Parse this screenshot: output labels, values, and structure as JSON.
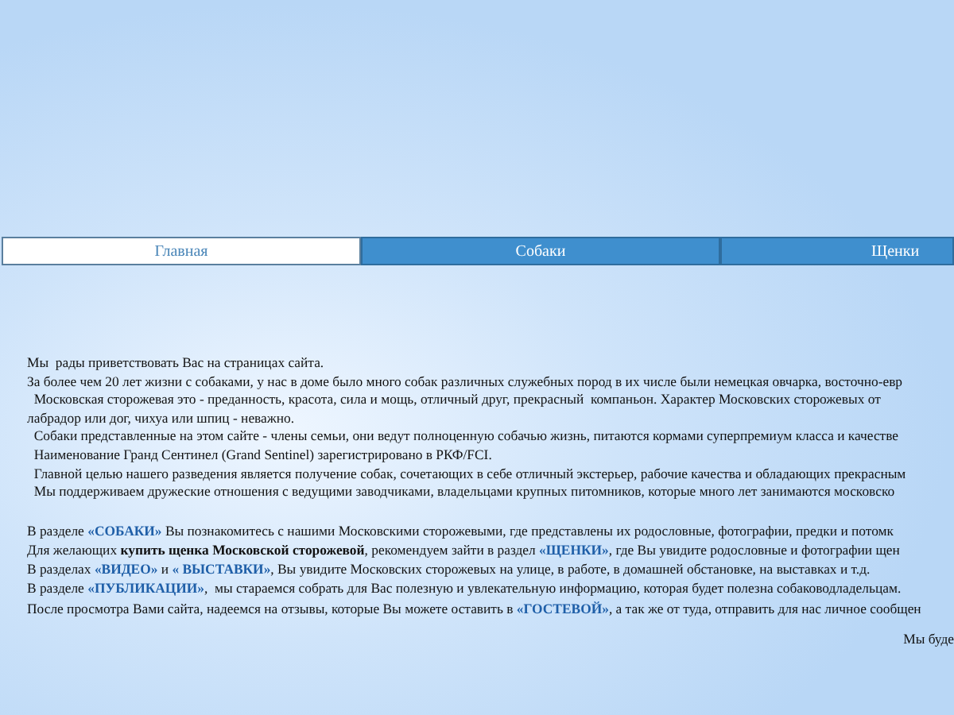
{
  "tabs": [
    {
      "label": "Главная",
      "selected": true
    },
    {
      "label": "Собаки",
      "selected": false
    },
    {
      "label": "Щенки",
      "selected": false
    }
  ],
  "intro": [
    [
      {
        "kind": "text",
        "text": "Мы  рады приветствовать Вас на страницах сайта."
      }
    ],
    [
      {
        "kind": "text",
        "text": "За более чем 20 лет жизни с собаками, у нас в доме было много собак различных служебных пород в их числе были немецкая овчарка, восточно-евр"
      }
    ],
    [
      {
        "kind": "text",
        "text": "  Московская сторожевая это - преданность, красота, сила и мощь, отличный друг, прекрасный  компаньон. Характер Московских сторожевых от"
      }
    ],
    [
      {
        "kind": "text",
        "text": "лабрадор или дог, чихуа или шпиц - неважно."
      }
    ],
    [
      {
        "kind": "text",
        "text": "  Собаки представленные на этом сайте - члены семьи, они ведут полноценную собачью жизнь, питаются кормами суперпремиум класса и качестве"
      }
    ],
    [
      {
        "kind": "text",
        "text": "  Наименование Гранд Сентинел (Grand Sentinel) зарегистрировано в РКФ/FCI."
      }
    ],
    [
      {
        "kind": "text",
        "text": "  Главной целью нашего разведения является получение собак, сочетающих в себе отличный экстерьер, рабочие качества и обладающих прекрасным"
      }
    ],
    [
      {
        "kind": "text",
        "text": "  Мы поддерживаем дружеские отношения с ведущими заводчиками, владельцами крупных питомников, которые много лет занимаются московско"
      }
    ]
  ],
  "sections": [
    [
      {
        "kind": "text",
        "text": "В разделе "
      },
      {
        "kind": "link",
        "text": "«СОБАКИ»"
      },
      {
        "kind": "text",
        "text": " Вы познакомитесь с нашими Московскими сторожевыми, где представлены их родословные, фотографии, предки и потомк"
      }
    ],
    [
      {
        "kind": "text",
        "text": "Для желающих "
      },
      {
        "kind": "bold",
        "text": "купить щенка Московской сторожевой"
      },
      {
        "kind": "text",
        "text": ", рекомендуем зайти в раздел "
      },
      {
        "kind": "link",
        "text": "«ЩЕНКИ»"
      },
      {
        "kind": "text",
        "text": ", где Вы увидите родословные и фотографии щен"
      }
    ],
    [
      {
        "kind": "text",
        "text": "В разделах "
      },
      {
        "kind": "link",
        "text": "«ВИДЕО»"
      },
      {
        "kind": "text",
        "text": " и "
      },
      {
        "kind": "link",
        "text": "« ВЫСТАВКИ»"
      },
      {
        "kind": "text",
        "text": ", Вы увидите Московских сторожевых на улице, в работе, в домашней обстановке, на выставках и т.д."
      }
    ],
    [
      {
        "kind": "text",
        "text": "В разделе "
      },
      {
        "kind": "link",
        "text": "«ПУБЛИКАЦИИ»"
      },
      {
        "kind": "text",
        "text": ",  мы стараемся собрать для Вас полезную и увлекательную информацию, которая будет полезна собаководладельцам."
      }
    ],
    [
      {
        "kind": "text",
        "text": "После просмотра Вами сайта, надеемся на отзывы, которые Вы можете оставить в "
      },
      {
        "kind": "link",
        "text": "«ГОСТЕВОЙ»"
      },
      {
        "kind": "text",
        "text": ", а так же от туда, отправить для нас личное сообщен"
      }
    ]
  ],
  "closing": "Мы буде"
}
